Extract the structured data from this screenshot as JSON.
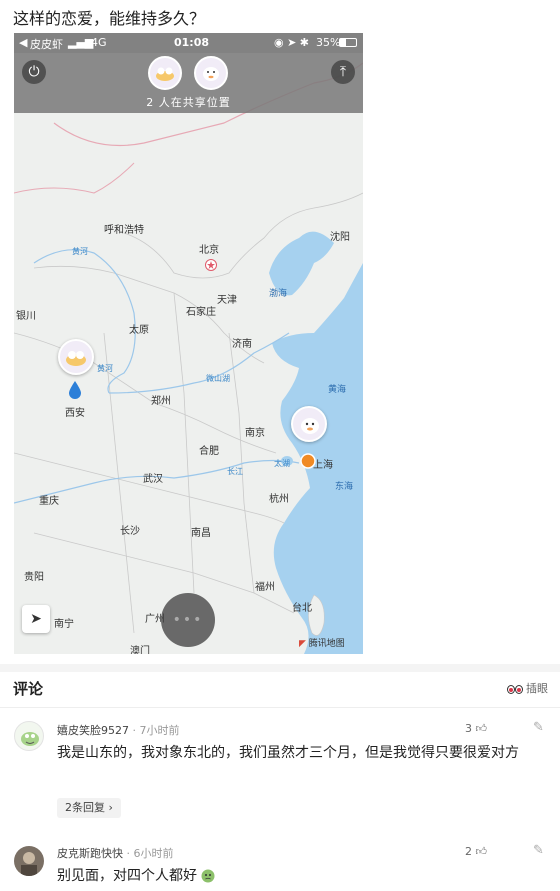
{
  "post": {
    "title": "这样的恋爱，能维持多久？"
  },
  "status_bar": {
    "carrier": "皮皮虾",
    "network": "4G",
    "time": "01:08",
    "battery": "35%"
  },
  "share_header": {
    "text": "2 人在共享位置"
  },
  "map": {
    "cities": [
      "呼和浩特",
      "北京",
      "沈阳",
      "天津",
      "银川",
      "太原",
      "石家庄",
      "济南",
      "西安",
      "郑州",
      "南京",
      "上海",
      "合肥",
      "武汉",
      "杭州",
      "重庆",
      "长沙",
      "南昌",
      "贵阳",
      "福州",
      "南宁",
      "广州",
      "台北",
      "澳门"
    ],
    "rivers": [
      "黄河",
      "黄河",
      "微山湖",
      "长江",
      "太湖"
    ],
    "seas": [
      "渤海",
      "黄海",
      "东海"
    ],
    "credit": "腾讯地图"
  },
  "comments_section": {
    "heading": "评论",
    "peek_label": "插眼",
    "comments": [
      {
        "username": "嬉皮笑脸9527",
        "time": "· 7小时前",
        "likes": "3",
        "text": "我是山东的，我对象东北的，我们虽然才三个月，但是我觉得只要很爱对方",
        "replies": "2条回复 ›"
      },
      {
        "username": "皮克斯跑快快",
        "time": "· 6小时前",
        "likes": "2",
        "text": "别见面，对四个人都好"
      }
    ]
  },
  "colors": {
    "sea": "#a6d1ef",
    "land": "#eef0ee",
    "accent_orange": "#f08a24",
    "pin_blue": "#2c7fd8"
  }
}
